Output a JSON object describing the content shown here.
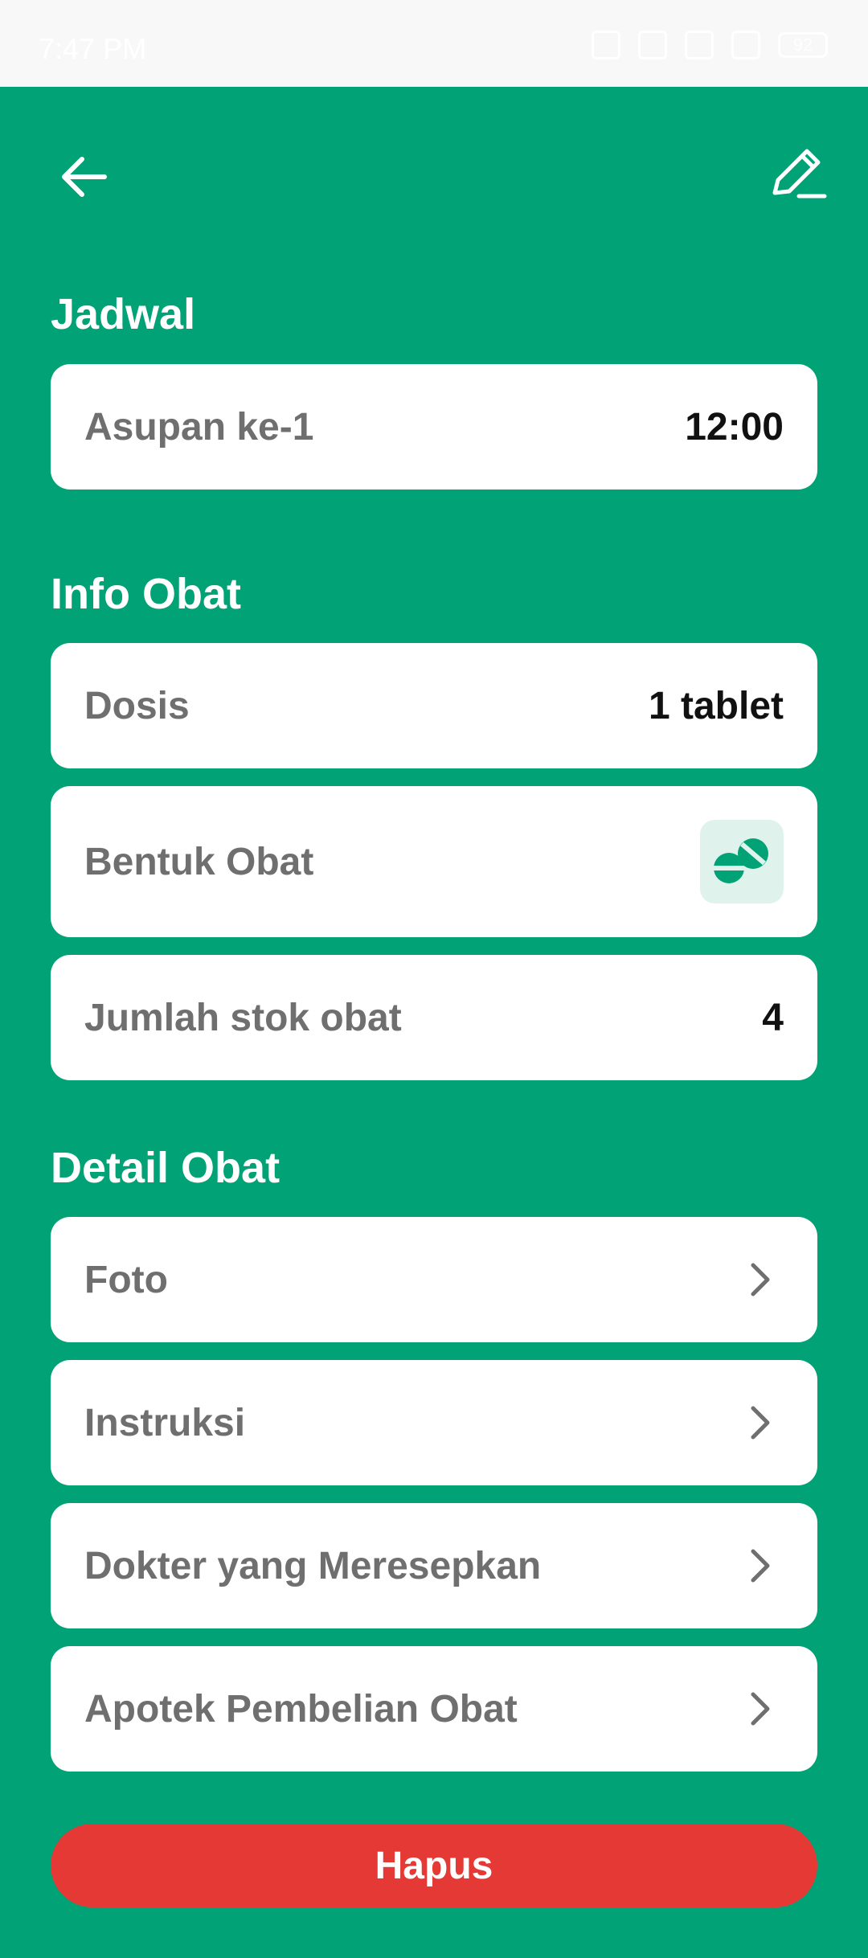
{
  "status_bar": {
    "time": "7:47 PM",
    "battery": "92"
  },
  "sections": {
    "schedule": {
      "title": "Jadwal",
      "item_label": "Asupan ke-1",
      "item_value": "12:00"
    },
    "medicine_info": {
      "title": "Info Obat",
      "dose_label": "Dosis",
      "dose_value": "1 tablet",
      "form_label": "Bentuk Obat",
      "form_icon": "tablet-pills-icon",
      "stock_label": "Jumlah stok obat",
      "stock_value": "4"
    },
    "medicine_detail": {
      "title": "Detail Obat",
      "items": [
        {
          "label": "Foto"
        },
        {
          "label": "Instruksi"
        },
        {
          "label": "Dokter yang Meresepkan"
        },
        {
          "label": "Apotek Pembelian Obat"
        }
      ]
    }
  },
  "actions": {
    "delete_label": "Hapus"
  },
  "colors": {
    "background": "#00a276",
    "card": "#ffffff",
    "label": "#6f6f6f",
    "value": "#111111",
    "delete": "#e53935",
    "icon_box": "#dff3ec",
    "icon_accent": "#00a276"
  }
}
